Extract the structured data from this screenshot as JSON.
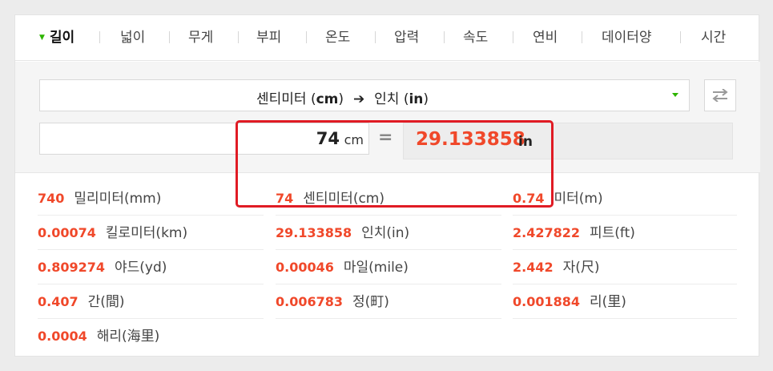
{
  "tabs": [
    "길이",
    "넓이",
    "무게",
    "부피",
    "온도",
    "압력",
    "속도",
    "연비",
    "데이터양",
    "시간"
  ],
  "active_tab": 0,
  "converter": {
    "from_unit_name": "센티미터",
    "from_unit_abbr": "cm",
    "to_unit_name": "인치",
    "to_unit_abbr": "in",
    "input_value": "74",
    "input_unit": "cm",
    "equals": "=",
    "output_value": "29.133858",
    "output_unit": "in"
  },
  "results": [
    {
      "value": "740",
      "unit": "밀리미터(mm)"
    },
    {
      "value": "74",
      "unit": "센티미터(cm)"
    },
    {
      "value": "0.74",
      "unit": "미터(m)"
    },
    {
      "value": "0.00074",
      "unit": "킬로미터(km)"
    },
    {
      "value": "29.133858",
      "unit": "인치(in)"
    },
    {
      "value": "2.427822",
      "unit": "피트(ft)"
    },
    {
      "value": "0.809274",
      "unit": "야드(yd)"
    },
    {
      "value": "0.00046",
      "unit": "마일(mile)"
    },
    {
      "value": "2.442",
      "unit": "자(尺)"
    },
    {
      "value": "0.407",
      "unit": "간(間)"
    },
    {
      "value": "0.006783",
      "unit": "정(町)"
    },
    {
      "value": "0.001884",
      "unit": "리(里)"
    },
    {
      "value": "0.0004",
      "unit": "해리(海里)"
    }
  ],
  "colors": {
    "accent": "#2db400",
    "value": "#f0482a",
    "highlight": "#e01b24"
  }
}
